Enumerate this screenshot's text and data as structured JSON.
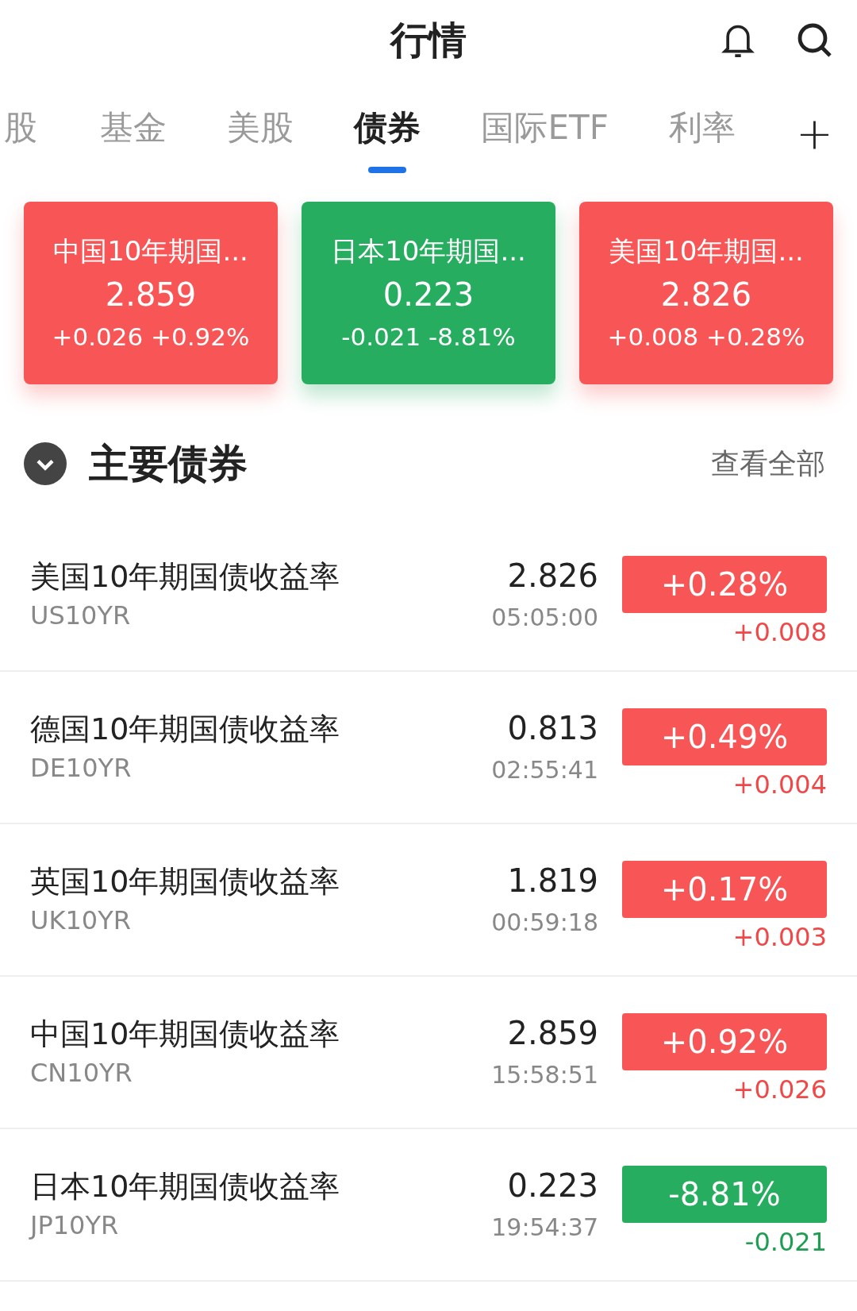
{
  "title": "行情",
  "tabs": [
    {
      "label": "股",
      "selected": false
    },
    {
      "label": "基金",
      "selected": false
    },
    {
      "label": "美股",
      "selected": false
    },
    {
      "label": "债券",
      "selected": true
    },
    {
      "label": "国际ETF",
      "selected": false
    },
    {
      "label": "利率",
      "selected": false
    }
  ],
  "add_tab": "+",
  "cards": [
    {
      "name": "中国10年期国...",
      "value": "2.859",
      "change": "+0.026 +0.92%",
      "kind": "up"
    },
    {
      "name": "日本10年期国...",
      "value": "0.223",
      "change": "-0.021 -8.81%",
      "kind": "down"
    },
    {
      "name": "美国10年期国...",
      "value": "2.826",
      "change": "+0.008 +0.28%",
      "kind": "up"
    }
  ],
  "section": {
    "title": "主要债券",
    "view_all": "查看全部"
  },
  "bonds": [
    {
      "name": "美国10年期国债收益率",
      "code": "US10YR",
      "value": "2.826",
      "time": "05:05:00",
      "percent": "+0.28%",
      "change": "+0.008",
      "kind": "up"
    },
    {
      "name": "德国10年期国债收益率",
      "code": "DE10YR",
      "value": "0.813",
      "time": "02:55:41",
      "percent": "+0.49%",
      "change": "+0.004",
      "kind": "up"
    },
    {
      "name": "英国10年期国债收益率",
      "code": "UK10YR",
      "value": "1.819",
      "time": "00:59:18",
      "percent": "+0.17%",
      "change": "+0.003",
      "kind": "up"
    },
    {
      "name": "中国10年期国债收益率",
      "code": "CN10YR",
      "value": "2.859",
      "time": "15:58:51",
      "percent": "+0.92%",
      "change": "+0.026",
      "kind": "up"
    },
    {
      "name": "日本10年期国债收益率",
      "code": "JP10YR",
      "value": "0.223",
      "time": "19:54:37",
      "percent": "-8.81%",
      "change": "-0.021",
      "kind": "down"
    }
  ]
}
